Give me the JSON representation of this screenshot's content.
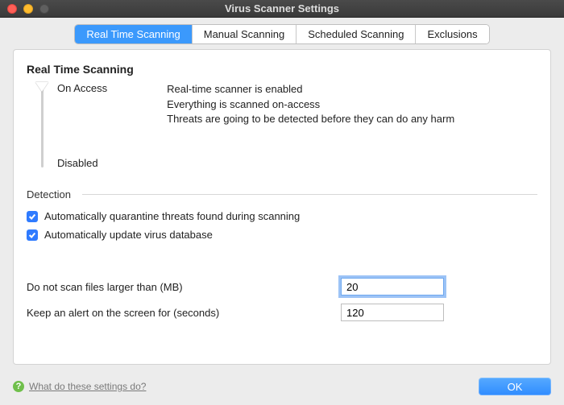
{
  "window": {
    "title": "Virus Scanner Settings"
  },
  "tabs": [
    {
      "label": "Real Time Scanning",
      "active": true
    },
    {
      "label": "Manual Scanning"
    },
    {
      "label": "Scheduled Scanning"
    },
    {
      "label": "Exclusions"
    }
  ],
  "panel": {
    "title": "Real Time Scanning",
    "slider": {
      "top": "On Access",
      "bottom": "Disabled"
    },
    "description": {
      "line1": "Real-time scanner is enabled",
      "line2": "Everything is scanned on-access",
      "line3": "Threats are going to be detected before they can do any harm"
    },
    "section": "Detection",
    "checks": {
      "quarantine": "Automatically quarantine threats found during scanning",
      "update": "Automatically update virus database"
    },
    "fields": {
      "fileSizeLabel": "Do not scan files larger than (MB)",
      "fileSizeValue": "20",
      "alertLabel": "Keep an alert on the screen for (seconds)",
      "alertValue": "120"
    }
  },
  "footer": {
    "help": "What do these settings do?",
    "ok": "OK"
  }
}
